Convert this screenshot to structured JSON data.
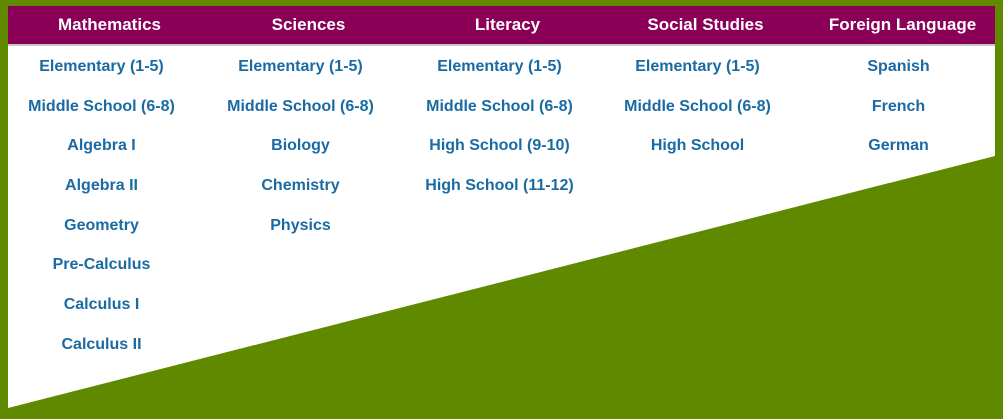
{
  "colors": {
    "background_green": "#5f8a00",
    "header_magenta": "#8a0057",
    "link_blue": "#1a6aa3",
    "panel_white": "#ffffff"
  },
  "header": {
    "columns": [
      "Mathematics",
      "Sciences",
      "Literacy",
      "Social Studies",
      "Foreign Language"
    ]
  },
  "columns": [
    {
      "items": [
        "Elementary (1-5)",
        "Middle School (6-8)",
        "Algebra I",
        "Algebra II",
        "Geometry",
        "Pre-Calculus",
        "Calculus I",
        "Calculus II"
      ]
    },
    {
      "items": [
        "Elementary (1-5)",
        "Middle School (6-8)",
        "Biology",
        "Chemistry",
        "Physics"
      ]
    },
    {
      "items": [
        "Elementary (1-5)",
        "Middle School (6-8)",
        "High School (9-10)",
        "High School (11-12)"
      ]
    },
    {
      "items": [
        "Elementary (1-5)",
        "Middle School (6-8)",
        "High School"
      ]
    },
    {
      "items": [
        "Spanish",
        "French",
        "German"
      ]
    }
  ]
}
